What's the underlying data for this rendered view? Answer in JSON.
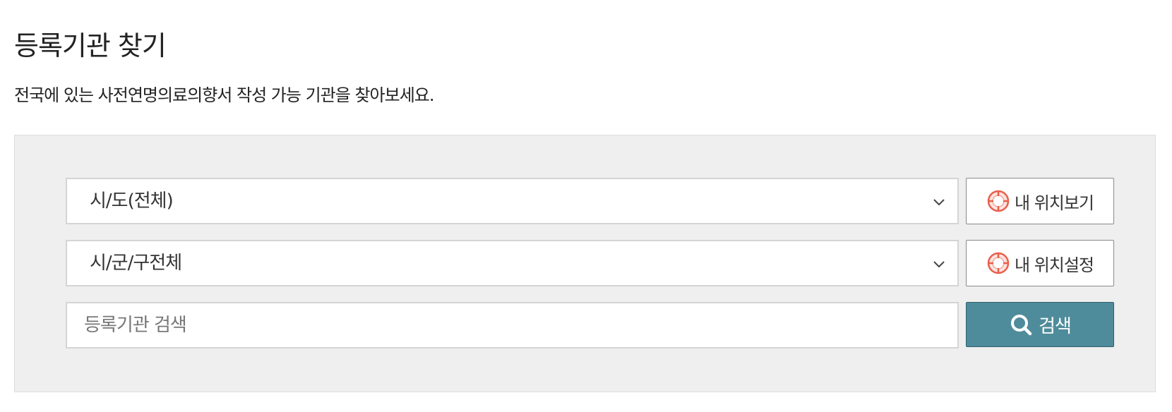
{
  "header": {
    "title": "등록기관 찾기",
    "description": "전국에 있는 사전연명의료의향서 작성 가능 기관을 찾아보세요."
  },
  "search_panel": {
    "region_select": {
      "selected": "시/도(전체)",
      "icon": "chevron-down-icon"
    },
    "district_select": {
      "selected": "시/군/구전체",
      "icon": "chevron-down-icon"
    },
    "keyword_input": {
      "value": "",
      "placeholder": "등록기관 검색"
    },
    "view_location_button": {
      "label": "내 위치보기",
      "icon": "target-icon"
    },
    "set_location_button": {
      "label": "내 위치설정",
      "icon": "target-icon"
    },
    "search_button": {
      "label": "검색",
      "icon": "search-icon"
    }
  },
  "colors": {
    "panel_background": "#efefef",
    "search_button": "#4f8c9b",
    "location_icon": "#e8604c"
  }
}
